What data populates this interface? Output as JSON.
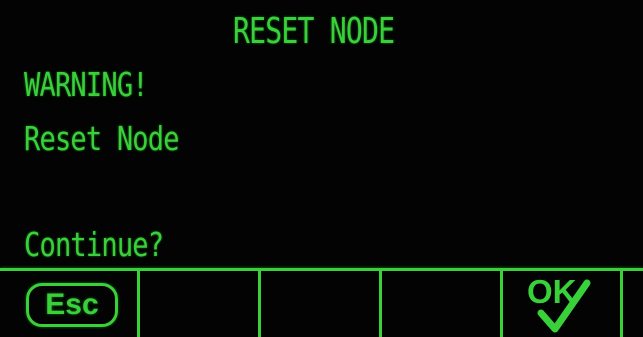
{
  "screen": {
    "title": "RESET NODE",
    "warning": "WARNING!",
    "message": "Reset Node",
    "prompt": "Continue?"
  },
  "softkeys": {
    "esc_label": "Esc",
    "ok_label": "OK",
    "ok_icon": "ok-check-icon"
  },
  "colors": {
    "text": "#39d13a",
    "background": "#020302"
  }
}
